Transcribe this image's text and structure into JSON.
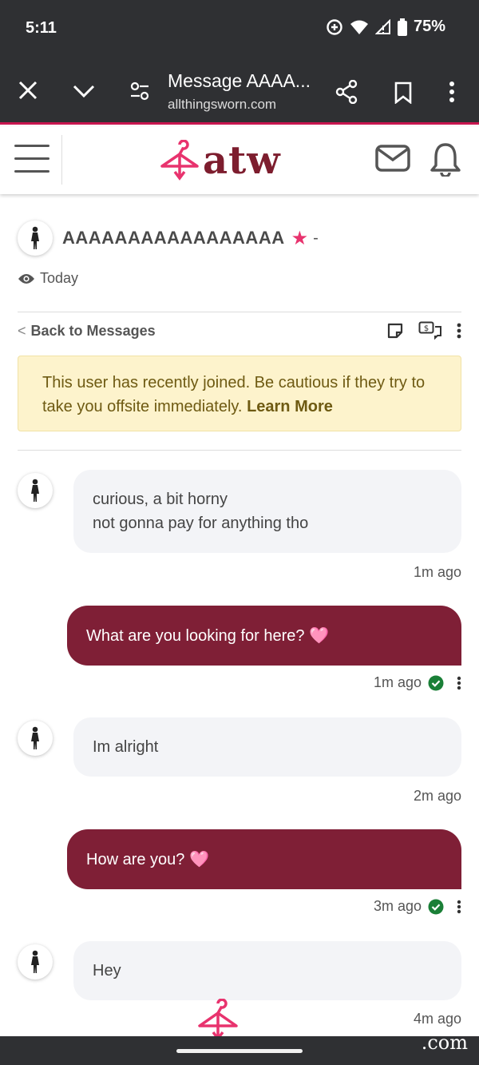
{
  "status_bar": {
    "time": "5:11",
    "battery": "75%"
  },
  "browser": {
    "title": "Message AAAA...",
    "url": "allthingsworn.com"
  },
  "site": {
    "logo_text": "atw",
    "brand_color": "#7d1d2e",
    "accent_color": "#e8336e"
  },
  "thread": {
    "username": "AAAAAAAAAAAAAAAAA",
    "username_suffix": "-",
    "last_seen": "Today",
    "back_label": "Back to Messages"
  },
  "warning": {
    "text": "This user has recently joined. Be cautious if they try to take you offsite immediately.",
    "link": "Learn More"
  },
  "messages": [
    {
      "direction": "in",
      "lines": [
        "curious, a bit horny",
        "not gonna pay for anything tho"
      ],
      "time": "1m ago"
    },
    {
      "direction": "out",
      "text": "What are you looking for here? 🩷",
      "time": "1m ago"
    },
    {
      "direction": "in",
      "lines": [
        "Im alright"
      ],
      "time": "2m ago"
    },
    {
      "direction": "out",
      "text": "How are you? 🩷",
      "time": "3m ago"
    },
    {
      "direction": "in",
      "lines": [
        "Hey"
      ],
      "time": "4m ago"
    }
  ],
  "nav": {
    "watermark": ".com"
  }
}
